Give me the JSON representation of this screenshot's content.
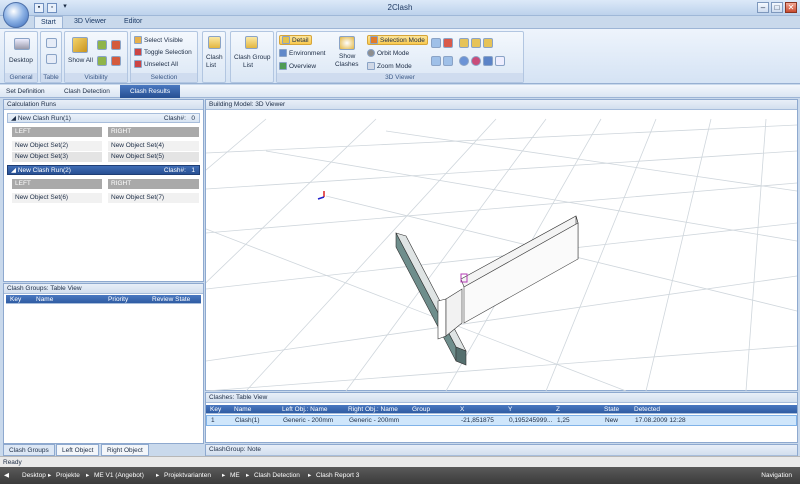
{
  "window": {
    "title": "2Clash"
  },
  "ribbon_tabs": [
    "Start",
    "3D Viewer",
    "Editor"
  ],
  "ribbon": {
    "general": {
      "label": "General",
      "desktop": "Desktop"
    },
    "table": {
      "label": "Table"
    },
    "visibility": {
      "label": "Visibility",
      "show_all": "Show All"
    },
    "selection": {
      "label": "Selection",
      "select_visible": "Select Visible",
      "toggle_selection": "Toggle Selection",
      "unselect_all": "Unselect All"
    },
    "clash_list": {
      "line1": "Clash",
      "line2": "List"
    },
    "clash_group_list": {
      "line1": "Clash Group",
      "line2": "List"
    },
    "viewer": {
      "label": "3D Viewer",
      "detail": "Detail",
      "environment": "Environment",
      "overview": "Overview",
      "show_clashes_1": "Show",
      "show_clashes_2": "Clashes",
      "selection_mode": "Selection Mode",
      "orbit_mode": "Orbit Mode",
      "zoom_mode": "Zoom Mode"
    }
  },
  "breadcrumb": [
    "Set Definition",
    "Clash Detection",
    "Clash Results"
  ],
  "calc_runs": {
    "title": "Calculation Runs",
    "runs": [
      {
        "name": "New Clash Run(1)",
        "count_label": "Clash#:",
        "count": "0",
        "left": "LEFT",
        "right": "RIGHT",
        "left_items": [
          "New Object Set(2)",
          "New Object Set(3)"
        ],
        "right_items": [
          "New Object Set(4)",
          "New Object Set(5)"
        ]
      },
      {
        "name": "New Clash Run(2)",
        "count_label": "Clash#:",
        "count": "1",
        "left": "LEFT",
        "right": "RIGHT",
        "left_items": [
          "New Object Set(6)"
        ],
        "right_items": [
          "New Object Set(7)"
        ]
      }
    ]
  },
  "clash_groups": {
    "title": "Clash Groups: Table View",
    "columns": [
      "Key",
      "Name",
      "Priority",
      "Review State"
    ]
  },
  "left_tabs": [
    "Clash Groups",
    "Left Object",
    "Right Object"
  ],
  "viewer_title": "Building Model: 3D Viewer",
  "clashes": {
    "title": "Clashes: Table View",
    "columns": [
      "Key",
      "Name",
      "Left Obj.: Name",
      "Right Obj.: Name",
      "Group",
      "X",
      "Y",
      "Z",
      "State",
      "Detected"
    ],
    "rows": [
      {
        "key": "1",
        "name": "Clash(1)",
        "left": "Generic - 200mm",
        "right": "Generic - 200mm",
        "group": "",
        "x": "-21,851875",
        "y": "0,195245999...",
        "z": "1,25",
        "state": "New",
        "detected": "17.08.2009 12:28"
      }
    ]
  },
  "note_title": "ClashGroup: Note",
  "status": "Ready",
  "nav": {
    "items": [
      "Desktop",
      "Projekte",
      "ME V1 (Angebot)",
      "Projektvarianten",
      "ME",
      "Clash Detection",
      "Clash Report 3"
    ],
    "right": "Navigation"
  },
  "colors": {
    "accent": "#2f5ca3",
    "ribbon": "#dbe7f5",
    "wall": "#6f8e8c"
  }
}
